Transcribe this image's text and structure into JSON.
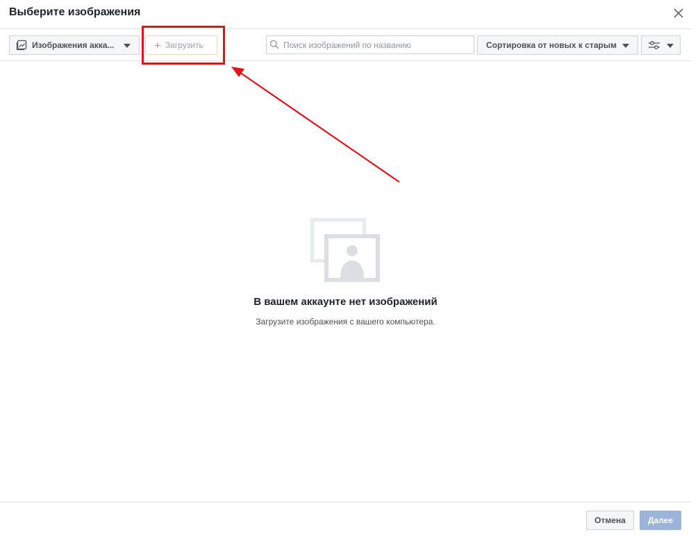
{
  "dialog": {
    "title": "Выберите изображения"
  },
  "toolbar": {
    "source_label": "Изображения акка...",
    "upload_label": "Загрузить",
    "search_placeholder": "Поиск изображений по названию",
    "search_value": "",
    "sort_label": "Сортировка от новых к старым"
  },
  "empty_state": {
    "title": "В вашем аккаунте нет изображений",
    "subtitle": "Загрузите изображения с вашего компьютера."
  },
  "footer": {
    "cancel_label": "Отмена",
    "next_label": "Далее"
  },
  "icons": {
    "close": "close-icon",
    "image_library": "image-library-icon",
    "plus": "plus-icon",
    "search": "search-icon",
    "filter": "sliders-icon",
    "dropdown": "chevron-down-icon",
    "empty_images": "empty-images-icon"
  },
  "colors": {
    "annotation_red": "#e0141b",
    "primary_disabled": "#9cb4d8",
    "border": "#dddfe2"
  }
}
